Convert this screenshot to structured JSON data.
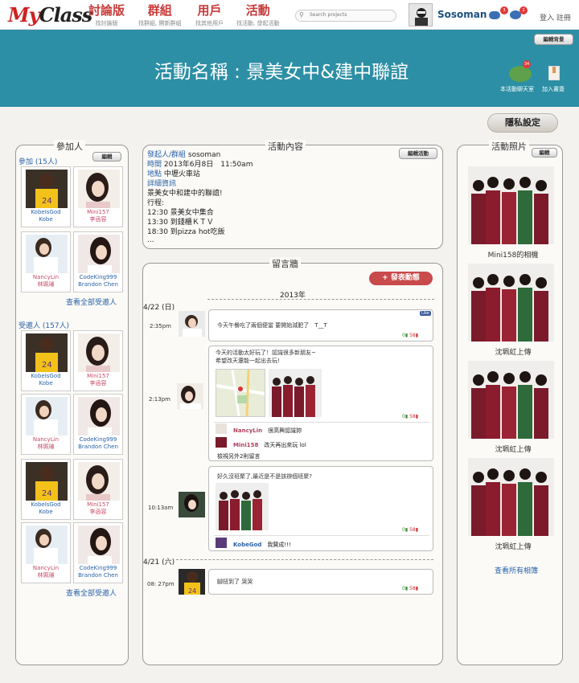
{
  "nav": {
    "logo_my": "My",
    "logo_class": "Class",
    "items": [
      {
        "label": "討論版",
        "sub": "找討論版"
      },
      {
        "label": "群組",
        "sub": "找群組, 開新群組"
      },
      {
        "label": "用戶",
        "sub": "找其他用戶"
      },
      {
        "label": "活動",
        "sub": "找活動, 發起活動"
      }
    ],
    "search_placeholder": "Search projects",
    "username": "Sosoman",
    "badge1": "3",
    "badge2": "2",
    "login": "登入 註冊"
  },
  "banner": {
    "title": "活動名稱 : 景美女中&建中聯誼",
    "edit_bg_label": "編輯背景",
    "chat_badge": "34",
    "chat_label": "本活動聊天室",
    "bookmark_label": "加入書簽"
  },
  "privacy_label": "隱私設定",
  "participants": {
    "title": "參加人",
    "edit_label": "編輯",
    "joined_label": "參加 (15人)",
    "invited_label": "受邀人 (157人)",
    "see_all": "查看全部受邀人",
    "joined": [
      {
        "n1": "KobeIsGod",
        "n2": "Kobe",
        "type": "kobe"
      },
      {
        "n1": "Mini157",
        "n2": "李函容",
        "type": "girl"
      },
      {
        "n1": "NancyLin",
        "n2": "林珮璿",
        "type": "girl2"
      },
      {
        "n1": "CodeKing999",
        "n2": "Brandon Chen",
        "type": "girl3"
      }
    ],
    "invited": [
      {
        "n1": "KobeIsGod",
        "n2": "Kobe",
        "type": "kobe"
      },
      {
        "n1": "Mini157",
        "n2": "李函容",
        "type": "girl"
      },
      {
        "n1": "NancyLin",
        "n2": "林珮璿",
        "type": "girl2"
      },
      {
        "n1": "CodeKing999",
        "n2": "Brandon Chen",
        "type": "girl3"
      },
      {
        "n1": "KobeIsGod",
        "n2": "Kobe",
        "type": "kobe"
      },
      {
        "n1": "Mini157",
        "n2": "李函容",
        "type": "girl"
      },
      {
        "n1": "NancyLin",
        "n2": "林珮璿",
        "type": "girl2"
      },
      {
        "n1": "CodeKing999",
        "n2": "Brandon Chen",
        "type": "girl3"
      }
    ]
  },
  "event": {
    "title": "活動內容",
    "edit_label": "編輯活動",
    "organizer_key": "發起人/群組",
    "organizer": "sosoman",
    "time_key": "時間",
    "time": "2013年6月8日　11:50am",
    "place_key": "地點",
    "place": "中壢火車站",
    "detail_key": "詳細資訊",
    "detail_lines": [
      "景美女中和建中的聯誼!",
      "行程:",
      "12:30 景美女中集合",
      "13:30 到錢櫃ＫＴＶ",
      "18:30 到pizza hot吃飯",
      "..."
    ]
  },
  "wall": {
    "title": "留言牆",
    "post_label": "+ 發表動態",
    "year": "2013年",
    "date1": "4/22 (日)",
    "date2": "4/21 (六)",
    "like_label": "Like",
    "posts": [
      {
        "time": "2:35pm",
        "text": "今天午餐吃了兩個便當 要開始減肥了　T__T",
        "up": "0",
        "down": "58"
      },
      {
        "time": "2:13pm",
        "text1": "今天的活動太好玩了！認識很多新朋友~",
        "text2": "希望改天還能一起出去玩!",
        "up": "0",
        "down": "58",
        "comments": [
          {
            "user": "NancyLin",
            "text": "很高興認識妳"
          },
          {
            "user": "Mini158",
            "text": "改天再出來玩 lol"
          }
        ],
        "more": "檢視另外2則留言"
      },
      {
        "time": "10:13am",
        "text": "好久沒班聚了,最近是不是該辦個班聚?",
        "up": "0",
        "down": "58",
        "comments": [
          {
            "user": "KobeGod",
            "text": "我贊成!!!"
          }
        ]
      },
      {
        "time": "08: 27pm",
        "text": "腳扭到了 哭哭",
        "up": "0",
        "down": "58"
      }
    ]
  },
  "photos": {
    "title": "活動照片",
    "edit_label": "編輯",
    "captions": [
      "Mini158的相機",
      "沈珮虹上傳",
      "沈珮虹上傳",
      "沈珮虹上傳"
    ],
    "see_all": "查看所有相簿"
  },
  "colors": {
    "banner": "#2c8fa5",
    "nav_red": "#c83a3a",
    "link_blue": "#2a63a8",
    "post_button": "#c84a4a"
  }
}
